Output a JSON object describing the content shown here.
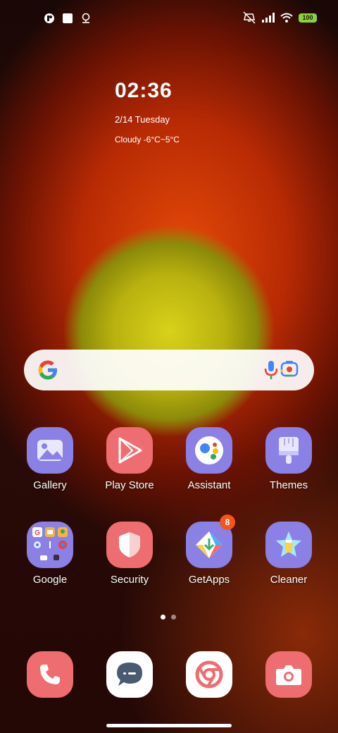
{
  "status_bar": {
    "left_icons": [
      "app-notification-icon",
      "square-notification-icon",
      "location-notification-icon"
    ],
    "right_icons": [
      "mute-vibrate-icon",
      "signal-icon",
      "wifi-icon"
    ],
    "battery": "100"
  },
  "widget": {
    "time": "02:36",
    "date": "2/14 Tuesday",
    "weather": "Cloudy -6°C~5°C"
  },
  "search_bar": {
    "icons": [
      "google-g-icon",
      "microphone-icon",
      "google-lens-icon"
    ]
  },
  "apps_row1": [
    {
      "label": "Gallery",
      "icon": "gallery-icon"
    },
    {
      "label": "Play Store",
      "icon": "play-store-icon"
    },
    {
      "label": "Assistant",
      "icon": "assistant-icon"
    },
    {
      "label": "Themes",
      "icon": "themes-icon"
    }
  ],
  "apps_row2": [
    {
      "label": "Google",
      "icon": "google-folder-icon"
    },
    {
      "label": "Security",
      "icon": "security-shield-icon"
    },
    {
      "label": "GetApps",
      "icon": "getapps-icon",
      "badge": "8"
    },
    {
      "label": "Cleaner",
      "icon": "cleaner-icon"
    }
  ],
  "page_indicator": {
    "pages": 2,
    "active": 1
  },
  "dock": [
    {
      "icon": "phone-icon"
    },
    {
      "icon": "messages-icon"
    },
    {
      "icon": "chrome-icon"
    },
    {
      "icon": "camera-icon"
    }
  ],
  "colors": {
    "accent_purple": "#8b80e6",
    "accent_red": "#ee6d70",
    "badge": "#f2561d"
  }
}
